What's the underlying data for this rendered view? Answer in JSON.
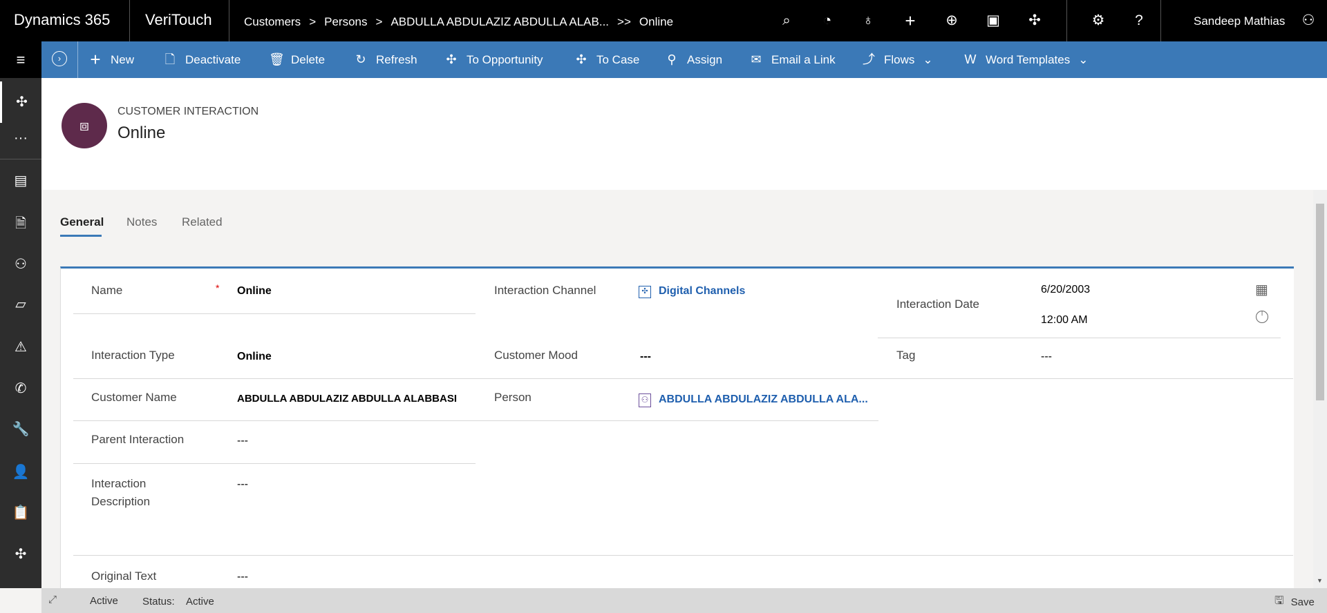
{
  "topbar": {
    "app": "Dynamics 365",
    "module": "VeriTouch",
    "breadcrumb": [
      "Customers",
      ">",
      "Persons",
      ">",
      "ABDULLA ABDULAZIZ ABDULLA ALAB...",
      ">>",
      "Online"
    ],
    "user": "Sandeep Mathias",
    "icons": [
      "search-icon",
      "task-icon",
      "lightbulb-icon",
      "plus-icon",
      "circle-plus-icon",
      "filter-icon",
      "puzzle-icon",
      "gear-icon",
      "help-icon",
      "user-icon"
    ]
  },
  "commands": {
    "new": "New",
    "deactivate": "Deactivate",
    "delete": "Delete",
    "refresh": "Refresh",
    "to_opportunity": "To Opportunity",
    "to_case": "To Case",
    "assign": "Assign",
    "email_link": "Email a Link",
    "flows": "Flows",
    "word_templates": "Word Templates"
  },
  "header": {
    "entity": "CUSTOMER INTERACTION",
    "title": "Online"
  },
  "tabs": [
    "General",
    "Notes",
    "Related"
  ],
  "form": {
    "name_label": "Name",
    "name_required": "*",
    "name_value": "Online",
    "type_label": "Interaction Type",
    "type_value": "Online",
    "customer_label": "Customer Name",
    "customer_value": "ABDULLA ABDULAZIZ ABDULLA ALABBASI",
    "parent_label": "Parent Interaction",
    "parent_value": "---",
    "desc_label_1": "Interaction",
    "desc_label_2": "Description",
    "desc_value": "---",
    "orig_label": "Original Text",
    "orig_value": "---",
    "channel_label": "Interaction Channel",
    "channel_value": "Digital Channels",
    "mood_label": "Customer Mood",
    "mood_value": "---",
    "person_label": "Person",
    "person_value": "ABDULLA ABDULAZIZ ABDULLA ALA...",
    "date_label": "Interaction Date",
    "date_value": "6/20/2003",
    "time_value": "12:00 AM",
    "tag_label": "Tag",
    "tag_value": "---"
  },
  "status": {
    "state": "Active",
    "status_label": "Status:",
    "status_value": "Active",
    "save": "Save"
  },
  "colors": {
    "accent": "#3b79b7",
    "avatar": "#5e2a4b",
    "link": "#1f5fae"
  }
}
